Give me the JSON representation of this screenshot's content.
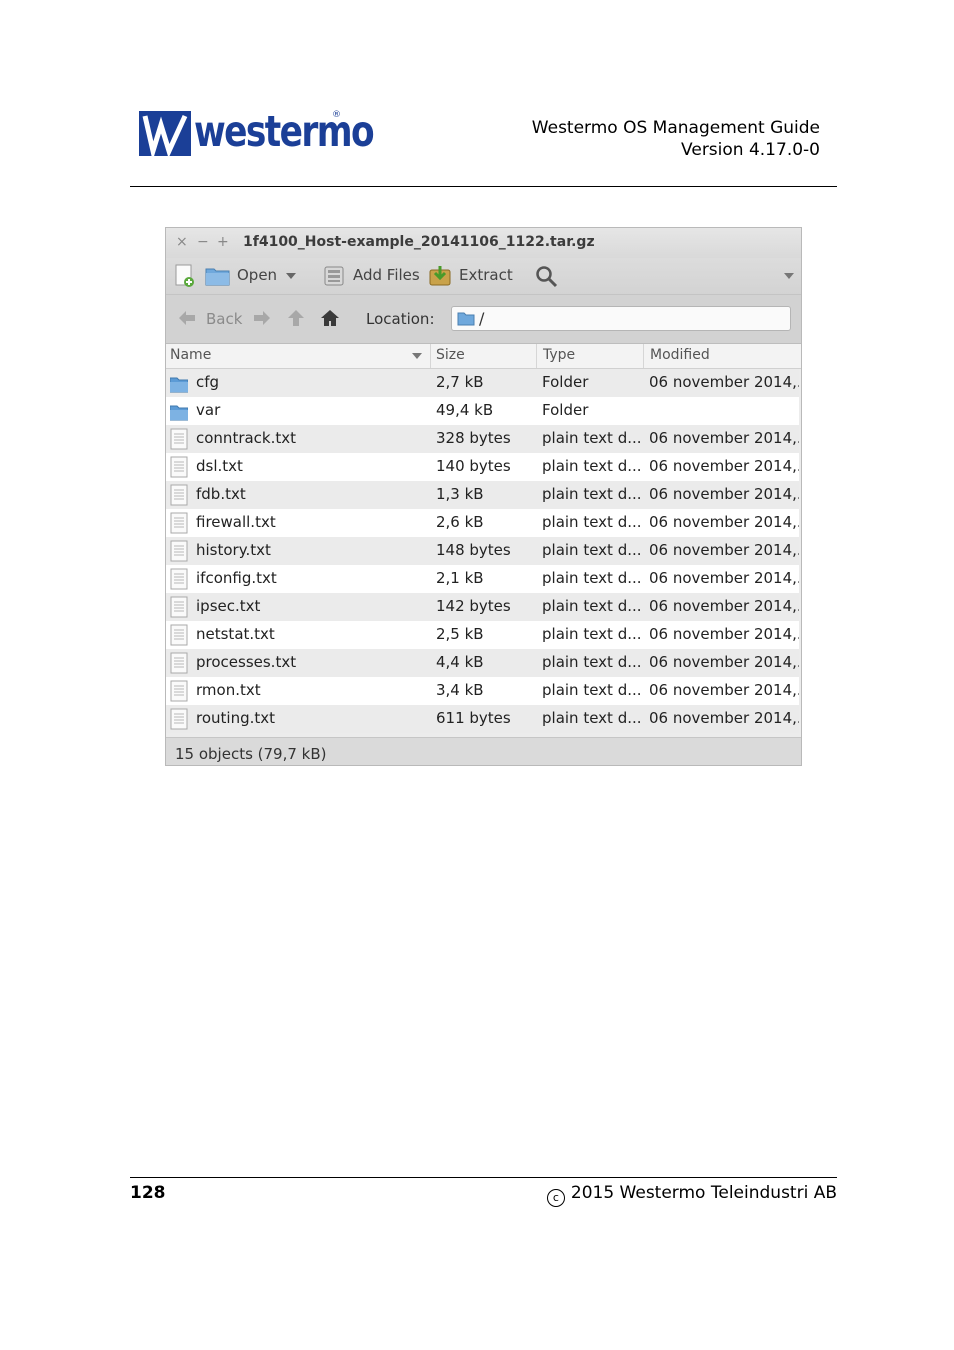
{
  "header": {
    "brand": "westermo",
    "guide_title": "Westermo OS Management Guide",
    "version": "Version 4.17.0-0"
  },
  "window": {
    "close_glyph": "×",
    "minimize_glyph": "−",
    "maximize_glyph": "+",
    "title": "1f4100_Host-example_20141106_1122.tar.gz",
    "toolbar": {
      "open_label": "Open",
      "add_files_label": "Add Files",
      "extract_label": "Extract"
    },
    "nav": {
      "back_label": "Back",
      "location_label": "Location:",
      "location_value": "/"
    },
    "columns": {
      "name": "Name",
      "size": "Size",
      "type": "Type",
      "modified": "Modified"
    },
    "files": [
      {
        "name": "cfg",
        "size": "2,7 kB",
        "type": "Folder",
        "modified": "06 november 2014,...",
        "icon": "folder-icon"
      },
      {
        "name": "var",
        "size": "49,4 kB",
        "type": "Folder",
        "modified": "",
        "icon": "folder-icon"
      },
      {
        "name": "conntrack.txt",
        "size": "328 bytes",
        "type": "plain text d...",
        "modified": "06 november 2014,...",
        "icon": "text-file-icon"
      },
      {
        "name": "dsl.txt",
        "size": "140 bytes",
        "type": "plain text d...",
        "modified": "06 november 2014,...",
        "icon": "text-file-icon"
      },
      {
        "name": "fdb.txt",
        "size": "1,3 kB",
        "type": "plain text d...",
        "modified": "06 november 2014,...",
        "icon": "text-file-icon"
      },
      {
        "name": "firewall.txt",
        "size": "2,6 kB",
        "type": "plain text d...",
        "modified": "06 november 2014,...",
        "icon": "text-file-icon"
      },
      {
        "name": "history.txt",
        "size": "148 bytes",
        "type": "plain text d...",
        "modified": "06 november 2014,...",
        "icon": "text-file-icon"
      },
      {
        "name": "ifconfig.txt",
        "size": "2,1 kB",
        "type": "plain text d...",
        "modified": "06 november 2014,...",
        "icon": "text-file-icon"
      },
      {
        "name": "ipsec.txt",
        "size": "142 bytes",
        "type": "plain text d...",
        "modified": "06 november 2014,...",
        "icon": "text-file-icon"
      },
      {
        "name": "netstat.txt",
        "size": "2,5 kB",
        "type": "plain text d...",
        "modified": "06 november 2014,...",
        "icon": "text-file-icon"
      },
      {
        "name": "processes.txt",
        "size": "4,4 kB",
        "type": "plain text d...",
        "modified": "06 november 2014,...",
        "icon": "text-file-icon"
      },
      {
        "name": "rmon.txt",
        "size": "3,4 kB",
        "type": "plain text d...",
        "modified": "06 november 2014,...",
        "icon": "text-file-icon"
      },
      {
        "name": "routing.txt",
        "size": "611 bytes",
        "type": "plain text d...",
        "modified": "06 november 2014,...",
        "icon": "text-file-icon"
      }
    ],
    "status": "15 objects (79,7 kB)"
  },
  "footer": {
    "page_number": "128",
    "copyright_symbol": "c",
    "copyright": "2015 Westermo Teleindustri AB"
  },
  "colors": {
    "brand_blue": "#1b3f97",
    "folder_blue": "#5c9bd6",
    "row_alt": "#ebebeb"
  }
}
